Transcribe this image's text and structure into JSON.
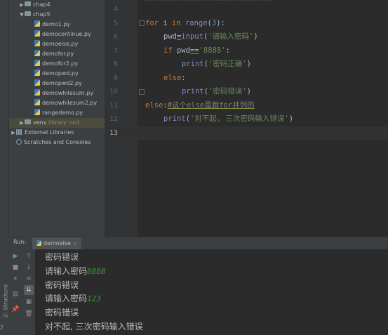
{
  "project_tree": {
    "items": [
      {
        "label": "chap4",
        "kind": "folder",
        "expanded": false
      },
      {
        "label": "chap5",
        "kind": "folder",
        "expanded": true
      },
      {
        "label": "demo1.py",
        "kind": "py"
      },
      {
        "label": "democontinue.py",
        "kind": "py"
      },
      {
        "label": "demoelse.py",
        "kind": "py"
      },
      {
        "label": "demofor.py",
        "kind": "py"
      },
      {
        "label": "demofor2.py",
        "kind": "py"
      },
      {
        "label": "demopwd.py",
        "kind": "py"
      },
      {
        "label": "demopwd2.py",
        "kind": "py"
      },
      {
        "label": "demowhilesum.py",
        "kind": "py"
      },
      {
        "label": "demowhilesum2.py",
        "kind": "py"
      },
      {
        "label": "rangedemo.py",
        "kind": "py"
      },
      {
        "label": "venv",
        "suffix": "library root",
        "kind": "folder",
        "expanded": false
      },
      {
        "label": "External Libraries",
        "kind": "lib",
        "expanded": false
      },
      {
        "label": "Scratches and Consoles",
        "kind": "scratch"
      }
    ]
  },
  "editor": {
    "line_numbers": [
      "4",
      "5",
      "6",
      "7",
      "8",
      "9",
      "10",
      "11",
      "12",
      "13"
    ],
    "current_line": "13",
    "code": {
      "l5_kw": "for",
      "l5_var": " i ",
      "l5_in": "in",
      "l5_fn": " range",
      "l5_open": "(",
      "l5_num": "3",
      "l5_close": "):",
      "l6_var": "pwd",
      "l6_eq": "=",
      "l6_fn": "input",
      "l6_open": "(",
      "l6_str": "'请输入密码'",
      "l6_close": ")",
      "l7_kw": "if",
      "l7_var": " pwd",
      "l7_op": "==",
      "l7_str": "'8888'",
      "l7_colon": ":",
      "l8_fn": "print",
      "l8_open": "(",
      "l8_str": "'密码正确'",
      "l8_close": ")",
      "l9_kw": "else",
      "l9_colon": ":",
      "l10_fn": "print",
      "l10_open": "(",
      "l10_str": "'密码错误'",
      "l10_close": ")",
      "l11_kw": "else",
      "l11_colon": ":",
      "l11_cmt": "#这个else是跟for并列的",
      "l12_fn": "print",
      "l12_open": "(",
      "l12_str": "'对不起, 三次密码输入错误'",
      "l12_close": ")"
    }
  },
  "run_panel": {
    "label": "Run:",
    "tab_label": "demoelse",
    "tab_close": "×",
    "output": [
      {
        "text": "密码错误"
      },
      {
        "text": "请输入密码",
        "input": "8888"
      },
      {
        "text": "密码错误"
      },
      {
        "text": "请输入密码",
        "input": "123"
      },
      {
        "text": "密码错误"
      },
      {
        "text": "对不起, 三次密码输入错误"
      }
    ]
  },
  "side_tabs": {
    "structure": "2: Structure",
    "favorites": "2"
  }
}
